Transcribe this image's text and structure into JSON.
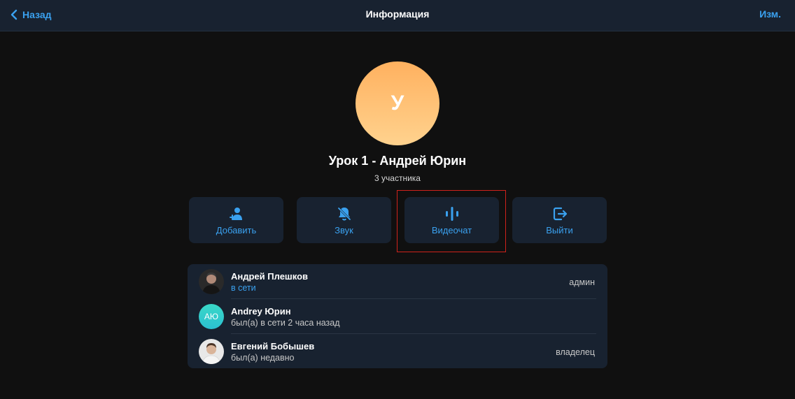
{
  "header": {
    "back_label": "Назад",
    "title": "Информация",
    "edit_label": "Изм."
  },
  "group": {
    "avatar_letter": "У",
    "name": "Урок 1 - Андрей Юрин",
    "members_count": "3 участника"
  },
  "actions": [
    {
      "label": "Добавить",
      "icon": "add-user-icon"
    },
    {
      "label": "Звук",
      "icon": "bell-muted-icon"
    },
    {
      "label": "Видеочат",
      "icon": "voice-wave-icon"
    },
    {
      "label": "Выйти",
      "icon": "exit-icon"
    }
  ],
  "members": [
    {
      "name": "Андрей Плешков",
      "status": "в сети",
      "role": "админ",
      "avatar": "photo"
    },
    {
      "name": "Andrey Юрин",
      "status": "был(а) в сети 2 часа назад",
      "role": "",
      "avatar_initials": "АЮ"
    },
    {
      "name": "Евгений Бобышев",
      "status": "был(а) недавно",
      "role": "владелец",
      "avatar": "photo"
    }
  ],
  "colors": {
    "accent": "#3aa1ef",
    "background": "#101010",
    "panel": "#182230",
    "highlight": "#d0221b"
  }
}
